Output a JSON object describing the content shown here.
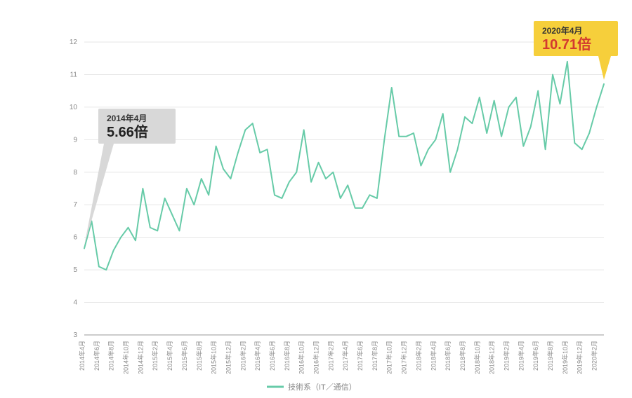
{
  "chart_data": {
    "type": "line",
    "title": "",
    "xlabel": "",
    "ylabel": "",
    "ylim": [
      3,
      12
    ],
    "y_ticks": [
      3,
      4,
      5,
      6,
      7,
      8,
      9,
      10,
      11,
      12
    ],
    "categories": [
      "2014年4月",
      "2014年6月",
      "2014年8月",
      "2014年10月",
      "2014年12月",
      "2015年2月",
      "2015年4月",
      "2015年6月",
      "2015年8月",
      "2015年10月",
      "2015年12月",
      "2016年2月",
      "2016年4月",
      "2016年6月",
      "2016年8月",
      "2016年10月",
      "2016年12月",
      "2017年2月",
      "2017年4月",
      "2017年6月",
      "2017年8月",
      "2017年10月",
      "2017年12月",
      "2018年2月",
      "2018年4月",
      "2018年6月",
      "2018年8月",
      "2018年10月",
      "2018年12月",
      "2019年2月",
      "2019年4月",
      "2019年6月",
      "2019年8月",
      "2019年10月",
      "2019年12月",
      "2020年2月",
      "2020年4月"
    ],
    "series": [
      {
        "name": "技術系（IT／通信）",
        "values_per_half_month": [
          5.66,
          6.5,
          5.1,
          5.0,
          5.6,
          6.0,
          6.3,
          5.9,
          7.5,
          6.3,
          6.2,
          7.2,
          6.7,
          6.2,
          7.5,
          7.0,
          7.8,
          7.3,
          8.8,
          8.1,
          7.8,
          8.6,
          9.3,
          9.5,
          8.6,
          8.7,
          7.3,
          7.2,
          7.7,
          8.0,
          9.3,
          7.7,
          8.3,
          7.8,
          8.0,
          7.2,
          7.6,
          6.9,
          6.9,
          7.3,
          7.2,
          9.0,
          10.6,
          9.1,
          9.1,
          9.2,
          8.2,
          8.7,
          9.0,
          9.8,
          8.0,
          8.7,
          9.7,
          9.5,
          10.3,
          9.2,
          10.2,
          9.1,
          10.0,
          10.3,
          8.8,
          9.4,
          10.5,
          8.7,
          11.0,
          10.1,
          11.4,
          8.9,
          8.7,
          9.2,
          10.0,
          10.71
        ]
      }
    ],
    "legend": {
      "label": "技術系（IT／通信）"
    },
    "callouts": {
      "start": {
        "date": "2014年4月",
        "value_text": "5.66倍"
      },
      "end": {
        "date": "2020年4月",
        "value_text": "10.71倍"
      }
    },
    "colors": {
      "line": "#67cba8",
      "callout_start_bg": "#d8d8d8",
      "callout_end_bg": "#f6cf3b",
      "callout_end_value": "#d33a2f"
    }
  }
}
